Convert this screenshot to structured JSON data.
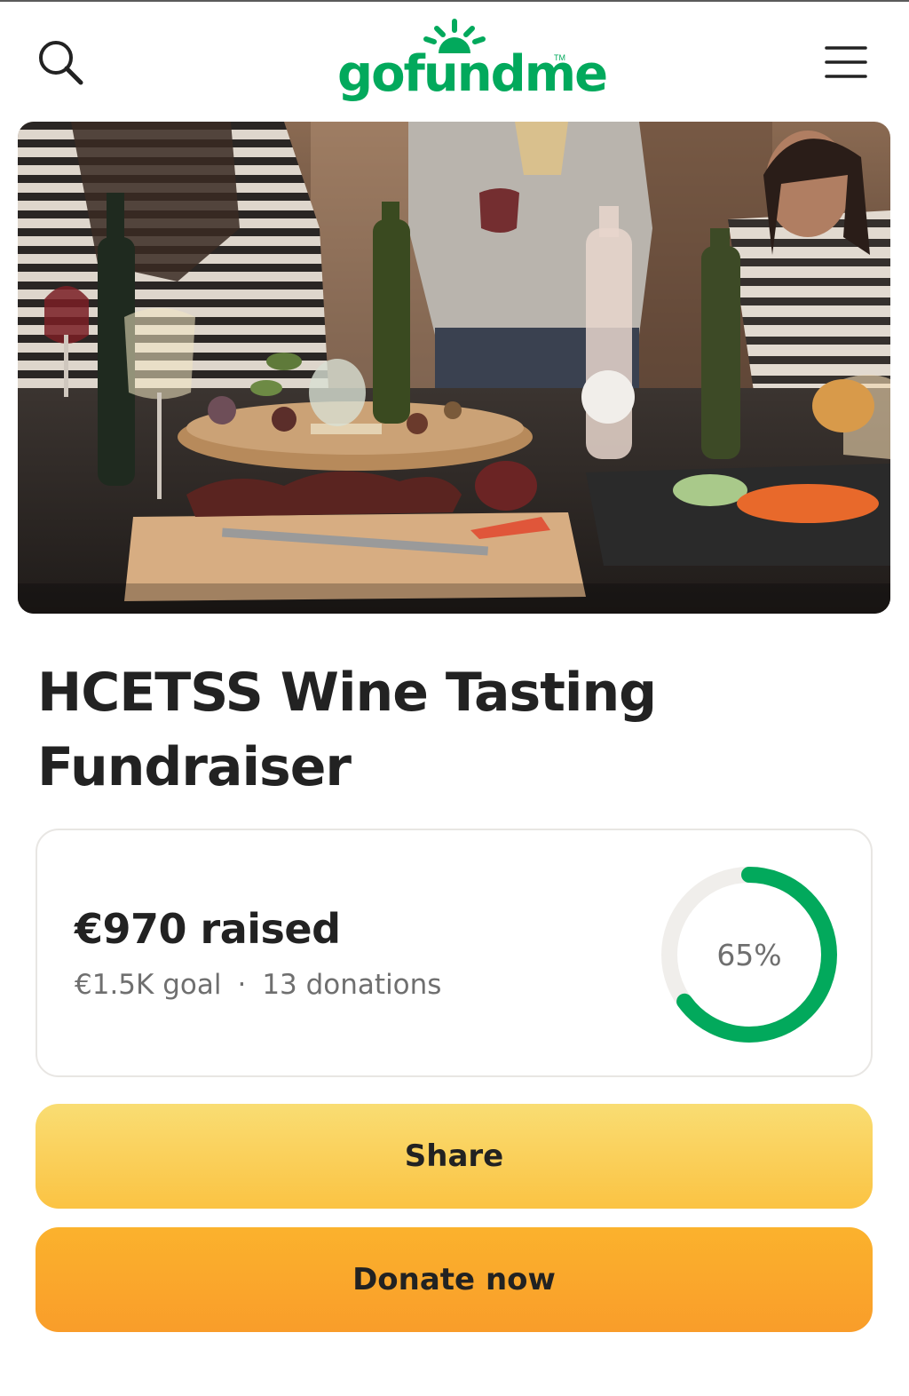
{
  "header": {
    "logo_text": "gofundme",
    "logo_tm": "TM",
    "search_icon": "search-icon",
    "menu_icon": "menu-icon",
    "brand_color": "#02a95c"
  },
  "hero": {
    "image_alt": "People at a wine tasting with a charcuterie board"
  },
  "campaign": {
    "title": "HCETSS Wine Tasting Fundraiser",
    "raised": "€970 raised",
    "goal": "€1.5K goal",
    "separator": "·",
    "donations": "13 donations",
    "progress_label": "65%",
    "progress_fraction": 0.65,
    "ring_color": "#02a95c",
    "ring_track_color": "#f0eeeb"
  },
  "actions": {
    "share_label": "Share",
    "donate_label": "Donate now"
  }
}
